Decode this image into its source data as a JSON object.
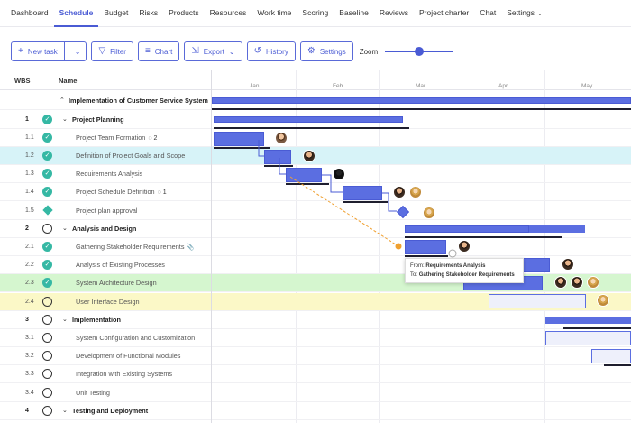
{
  "nav": {
    "items": [
      {
        "label": "Dashboard",
        "active": false
      },
      {
        "label": "Schedule",
        "active": true
      },
      {
        "label": "Budget",
        "active": false
      },
      {
        "label": "Risks",
        "active": false
      },
      {
        "label": "Products",
        "active": false
      },
      {
        "label": "Resources",
        "active": false
      },
      {
        "label": "Work time",
        "active": false
      },
      {
        "label": "Scoring",
        "active": false
      },
      {
        "label": "Baseline",
        "active": false
      },
      {
        "label": "Reviews",
        "active": false
      },
      {
        "label": "Project charter",
        "active": false
      },
      {
        "label": "Chat",
        "active": false
      },
      {
        "label": "Settings",
        "active": false
      }
    ]
  },
  "toolbar": {
    "new_task": "New task",
    "filter": "Filter",
    "chart": "Chart",
    "export": "Export",
    "history": "History",
    "settings": "Settings",
    "zoom": "Zoom",
    "zoom_level": 0.45
  },
  "grid": {
    "wbs_header": "WBS",
    "name_header": "Name",
    "root": "Implementation of Customer Service System",
    "rows": [
      {
        "wbs": "1",
        "name": "Project Planning",
        "status": "done",
        "level": 1,
        "comments": ""
      },
      {
        "wbs": "1.1",
        "name": "Project Team Formation",
        "status": "done",
        "level": 2,
        "comments": "2"
      },
      {
        "wbs": "1.2",
        "name": "Definition of Project Goals and Scope",
        "status": "done",
        "level": 2,
        "comments": ""
      },
      {
        "wbs": "1.3",
        "name": "Requirements Analysis",
        "status": "done",
        "level": 2,
        "comments": ""
      },
      {
        "wbs": "1.4",
        "name": "Project Schedule Definition",
        "status": "done",
        "level": 2,
        "comments": "1"
      },
      {
        "wbs": "1.5",
        "name": "Project plan approval",
        "status": "milestone",
        "level": 2,
        "comments": ""
      },
      {
        "wbs": "2",
        "name": "Analysis and Design",
        "status": "open",
        "level": 1,
        "comments": ""
      },
      {
        "wbs": "2.1",
        "name": "Gathering Stakeholder Requirements",
        "status": "done",
        "level": 2,
        "comments": ""
      },
      {
        "wbs": "2.2",
        "name": "Analysis of Existing Processes",
        "status": "done",
        "level": 2,
        "comments": ""
      },
      {
        "wbs": "2.3",
        "name": "System Architecture Design",
        "status": "done",
        "level": 2,
        "comments": ""
      },
      {
        "wbs": "2.4",
        "name": "User Interface Design",
        "status": "open",
        "level": 2,
        "comments": ""
      },
      {
        "wbs": "3",
        "name": "Implementation",
        "status": "open",
        "level": 1,
        "comments": ""
      },
      {
        "wbs": "3.1",
        "name": "System Configuration and Customization",
        "status": "open",
        "level": 2,
        "comments": ""
      },
      {
        "wbs": "3.2",
        "name": "Development of Functional Modules",
        "status": "open",
        "level": 2,
        "comments": ""
      },
      {
        "wbs": "3.3",
        "name": "Integration with Existing Systems",
        "status": "open",
        "level": 2,
        "comments": ""
      },
      {
        "wbs": "3.4",
        "name": "Unit Testing",
        "status": "open",
        "level": 2,
        "comments": ""
      },
      {
        "wbs": "4",
        "name": "Testing and Deployment",
        "status": "open",
        "level": 1,
        "comments": ""
      }
    ]
  },
  "timeline": {
    "months": [
      "Jan",
      "Feb",
      "Mar",
      "Apr",
      "May"
    ]
  },
  "tooltip": {
    "from_label": "From:",
    "from_value": "Requirements Analysis",
    "to_label": "To:",
    "to_value": "Gathering Stakeholder Requirements"
  },
  "colors": {
    "accent": "#4a5bd4",
    "bar": "#5b6ee1",
    "done": "#35b8a4",
    "dependency": "#f0a030"
  }
}
